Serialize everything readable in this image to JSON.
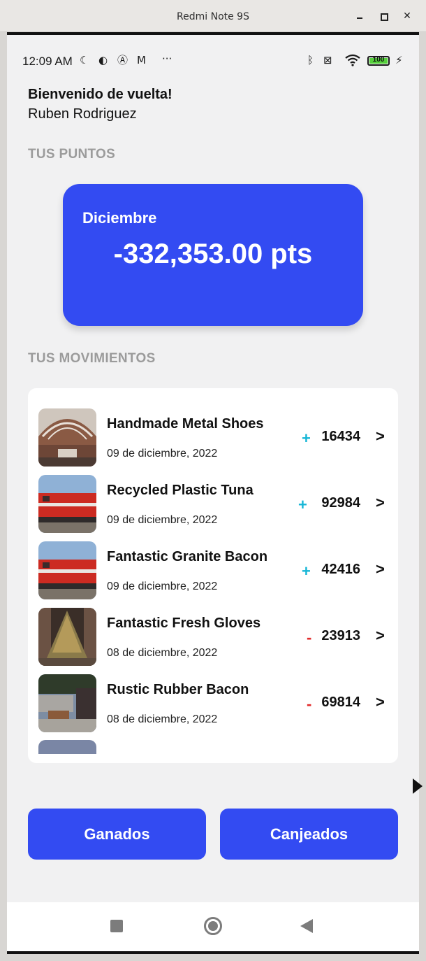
{
  "window": {
    "title": "Redmi Note 9S"
  },
  "status_bar": {
    "time": "12:09 AM",
    "more": "···",
    "battery": "100",
    "left_icons": [
      "moon-icon",
      "data-saver-icon",
      "vpn-icon",
      "gmail-icon"
    ],
    "right_icons": [
      "bluetooth-icon",
      "no-sim-icon",
      "wifi-icon",
      "battery-icon",
      "charging-icon"
    ]
  },
  "header": {
    "greeting": "Bienvenido de vuelta!",
    "user_name": "Ruben Rodriguez"
  },
  "points": {
    "section_label": "TUS PUNTOS",
    "month": "Diciembre",
    "amount": "-332,353.00 pts"
  },
  "movements": {
    "section_label": "TUS MOVIMIENTOS",
    "items": [
      {
        "title": "Handmade Metal Shoes",
        "date": "09 de diciembre, 2022",
        "sign": "+",
        "value": "16434",
        "image": "train-station"
      },
      {
        "title": "Recycled Plastic Tuna",
        "date": "09 de diciembre, 2022",
        "sign": "+",
        "value": "92984",
        "image": "red-train"
      },
      {
        "title": "Fantastic Granite Bacon",
        "date": "09 de diciembre, 2022",
        "sign": "+",
        "value": "42416",
        "image": "red-train"
      },
      {
        "title": "Fantastic Fresh Gloves",
        "date": "08 de diciembre, 2022",
        "sign": "-",
        "value": "23913",
        "image": "christmas-tree"
      },
      {
        "title": "Rustic Rubber Bacon",
        "date": "08 de diciembre, 2022",
        "sign": "-",
        "value": "69814",
        "image": "street-cafe"
      }
    ],
    "chevron": ">"
  },
  "actions": {
    "earned_label": "Ganados",
    "redeemed_label": "Canjeados"
  },
  "colors": {
    "accent": "#334bf2",
    "plus": "#16b6d6",
    "minus": "#e22b2b",
    "background": "#f1f1f2"
  }
}
